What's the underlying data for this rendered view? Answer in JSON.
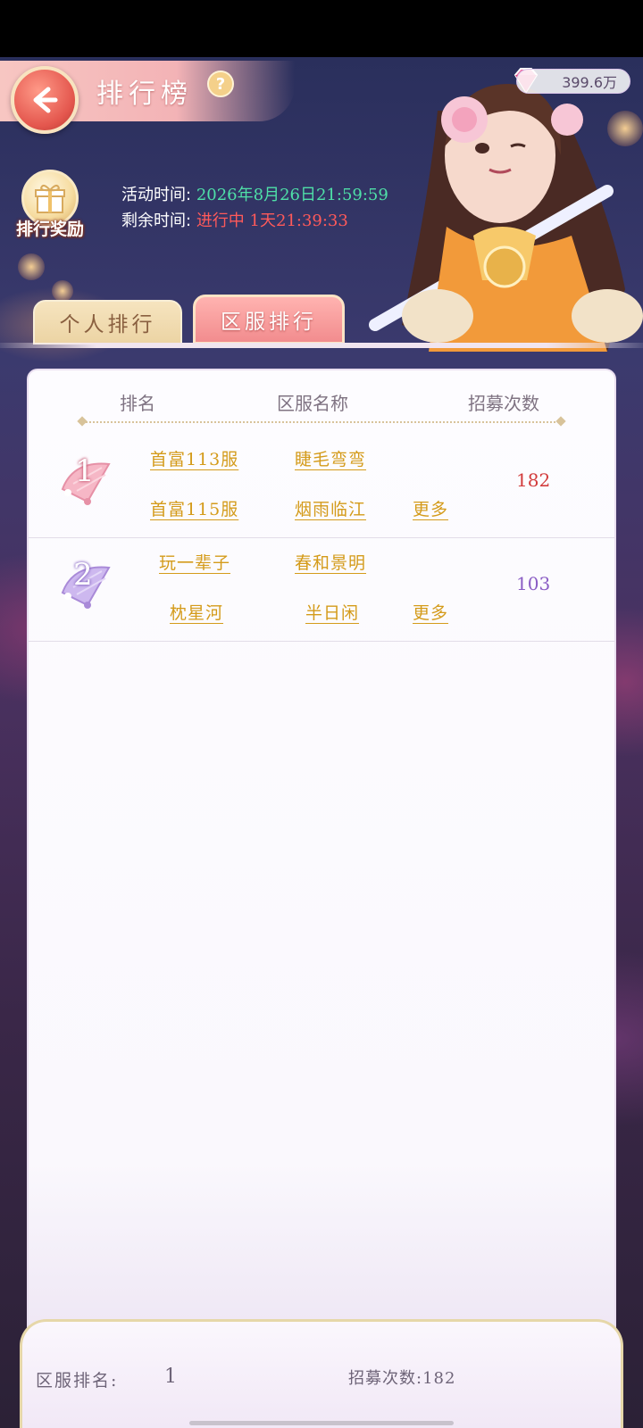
{
  "header": {
    "title": "排行榜",
    "help_glyph": "?",
    "currency_value": "399.6万",
    "currency_icon": "gem-icon"
  },
  "event": {
    "reward_label": "排行奖励",
    "activity_label": "活动时间:",
    "activity_value": "2026年8月26日21:59:59",
    "remaining_label": "剩余时间:",
    "remaining_value": "进行中 1天21:39:33"
  },
  "tabs": [
    {
      "label": "个人排行",
      "active": false
    },
    {
      "label": "区服排行",
      "active": true
    }
  ],
  "table": {
    "columns": [
      "排名",
      "区服名称",
      "招募次数"
    ],
    "rows": [
      {
        "rank": "1",
        "servers": [
          "首富113服",
          "睫毛弯弯",
          "首富115服",
          "烟雨临江"
        ],
        "more": "更多",
        "count": "182",
        "count_color": "#d23b3b"
      },
      {
        "rank": "2",
        "servers": [
          "玩一辈子",
          "春和景明",
          "枕星河",
          "半日闲"
        ],
        "more": "更多",
        "count": "103",
        "count_color": "#8a5cc4"
      }
    ]
  },
  "footer": {
    "rank_label": "区服排名:",
    "rank_value": "1",
    "count_label": "招募次数:",
    "count_value": "182"
  },
  "colors": {
    "gold_link": "#d49b1a",
    "accent_pink": "#f28c8e"
  }
}
